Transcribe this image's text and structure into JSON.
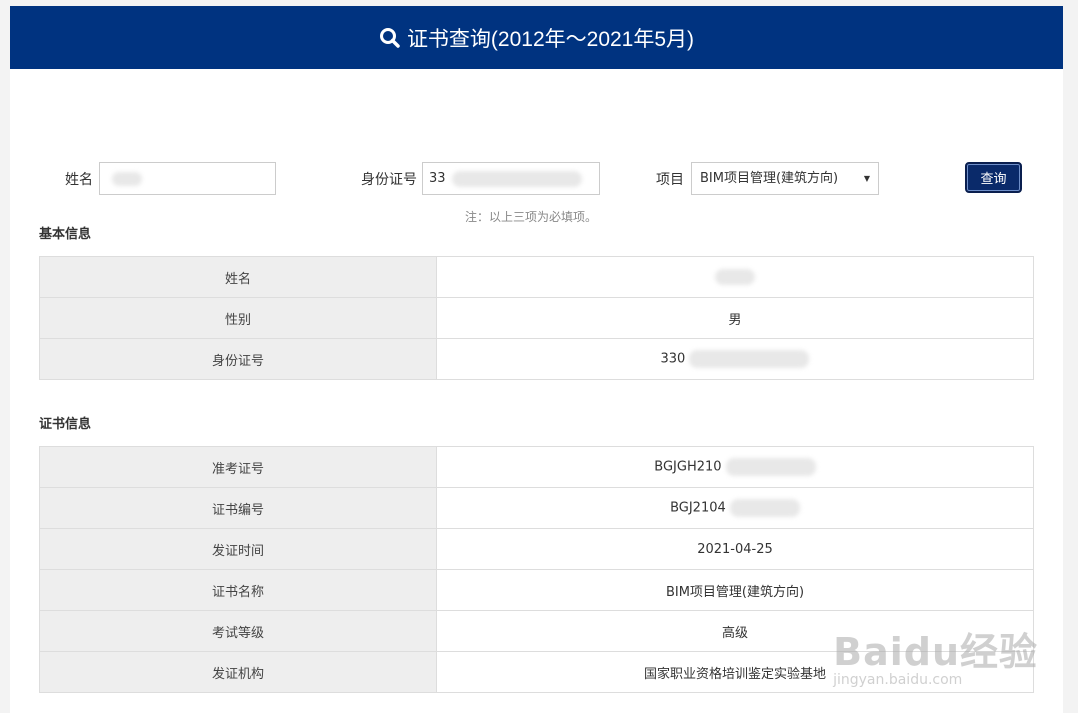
{
  "header": {
    "title": "证书查询(2012年～2021年5月)",
    "icon": "search-icon"
  },
  "form": {
    "name_label": "姓名",
    "name_value": "",
    "id_label": "身份证号",
    "id_value": "33",
    "project_label": "项目",
    "project_value": "BIM项目管理(建筑方向)",
    "query_button": "查询",
    "note": "注：以上三项为必填项。"
  },
  "basic": {
    "title": "基本信息",
    "rows": [
      {
        "key": "姓名",
        "value": ""
      },
      {
        "key": "性别",
        "value": "男"
      },
      {
        "key": "身份证号",
        "value": "330"
      }
    ]
  },
  "cert": {
    "title": "证书信息",
    "rows": [
      {
        "key": "准考证号",
        "value": "BGJGH210"
      },
      {
        "key": "证书编号",
        "value": "BGJ2104"
      },
      {
        "key": "发证时间",
        "value": "2021-04-25"
      },
      {
        "key": "证书名称",
        "value": "BIM项目管理(建筑方向)"
      },
      {
        "key": "考试等级",
        "value": "高级"
      },
      {
        "key": "发证机构",
        "value": "国家职业资格培训鉴定实验基地"
      }
    ]
  },
  "watermark": {
    "brand": "Baidu经验",
    "url": "jingyan.baidu.com"
  },
  "colors": {
    "header_bg": "#003380",
    "button_bg": "#0a2a6a"
  }
}
